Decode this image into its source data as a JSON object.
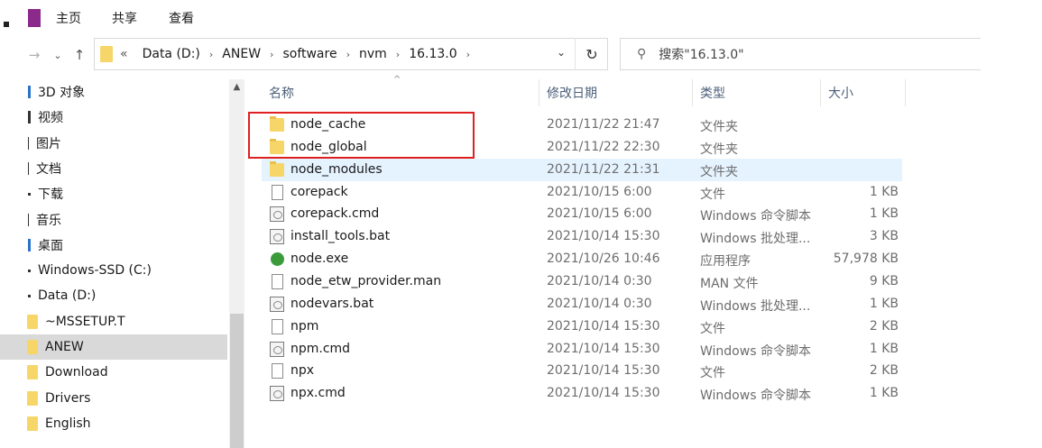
{
  "ribbon": {
    "tabs": [
      "主页",
      "共享",
      "查看"
    ]
  },
  "nav": {
    "back_icon": "back-arrow-icon",
    "forward_icon": "chevron-down-icon",
    "up_icon": "up-arrow-icon"
  },
  "address": {
    "prefix": "«",
    "crumbs": [
      "Data (D:)",
      "ANEW",
      "software",
      "nvm",
      "16.13.0"
    ]
  },
  "search": {
    "placeholder": "搜索\"16.13.0\""
  },
  "navpane": {
    "items": [
      {
        "label": "3D 对象",
        "kind": "mark-blue"
      },
      {
        "label": "视频",
        "kind": "mark"
      },
      {
        "label": "图片",
        "kind": "mark-thin"
      },
      {
        "label": "文档",
        "kind": "mark-thin"
      },
      {
        "label": "下载",
        "kind": "mark-dot"
      },
      {
        "label": "音乐",
        "kind": "mark-thin"
      },
      {
        "label": "桌面",
        "kind": "mark-blue"
      },
      {
        "label": "Windows-SSD (C:)",
        "kind": "mark-dot"
      },
      {
        "label": "Data (D:)",
        "kind": "mark-dot"
      },
      {
        "label": "~MSSETUP.T",
        "kind": "folder"
      },
      {
        "label": "ANEW",
        "kind": "folder",
        "selected": true
      },
      {
        "label": "Download",
        "kind": "folder"
      },
      {
        "label": "Drivers",
        "kind": "folder"
      },
      {
        "label": "English",
        "kind": "folder"
      }
    ]
  },
  "columns": {
    "name": "名称",
    "date": "修改日期",
    "type": "类型",
    "size": "大小"
  },
  "files": [
    {
      "name": "node_cache",
      "date": "2021/11/22 21:47",
      "type": "文件夹",
      "size": "",
      "icon": "folder"
    },
    {
      "name": "node_global",
      "date": "2021/11/22 22:30",
      "type": "文件夹",
      "size": "",
      "icon": "folder"
    },
    {
      "name": "node_modules",
      "date": "2021/11/22 21:31",
      "type": "文件夹",
      "size": "",
      "icon": "folder",
      "highlight": true
    },
    {
      "name": "corepack",
      "date": "2021/10/15 6:00",
      "type": "文件",
      "size": "1 KB",
      "icon": "file"
    },
    {
      "name": "corepack.cmd",
      "date": "2021/10/15 6:00",
      "type": "Windows 命令脚本",
      "size": "1 KB",
      "icon": "cmd"
    },
    {
      "name": "install_tools.bat",
      "date": "2021/10/14 15:30",
      "type": "Windows 批处理...",
      "size": "3 KB",
      "icon": "cmd"
    },
    {
      "name": "node.exe",
      "date": "2021/10/26 10:46",
      "type": "应用程序",
      "size": "57,978 KB",
      "icon": "exe"
    },
    {
      "name": "node_etw_provider.man",
      "date": "2021/10/14 0:30",
      "type": "MAN 文件",
      "size": "9 KB",
      "icon": "file"
    },
    {
      "name": "nodevars.bat",
      "date": "2021/10/14 0:30",
      "type": "Windows 批处理...",
      "size": "1 KB",
      "icon": "cmd"
    },
    {
      "name": "npm",
      "date": "2021/10/14 15:30",
      "type": "文件",
      "size": "2 KB",
      "icon": "file"
    },
    {
      "name": "npm.cmd",
      "date": "2021/10/14 15:30",
      "type": "Windows 命令脚本",
      "size": "1 KB",
      "icon": "cmd"
    },
    {
      "name": "npx",
      "date": "2021/10/14 15:30",
      "type": "文件",
      "size": "2 KB",
      "icon": "file"
    },
    {
      "name": "npx.cmd",
      "date": "2021/10/14 15:30",
      "type": "Windows 命令脚本",
      "size": "1 KB",
      "icon": "cmd"
    }
  ],
  "colors": {
    "ribbon_accent": "#8b2a8b",
    "folder": "#f7d669",
    "highlight_row": "#e5f3ff",
    "annotation_box": "#e02020"
  }
}
